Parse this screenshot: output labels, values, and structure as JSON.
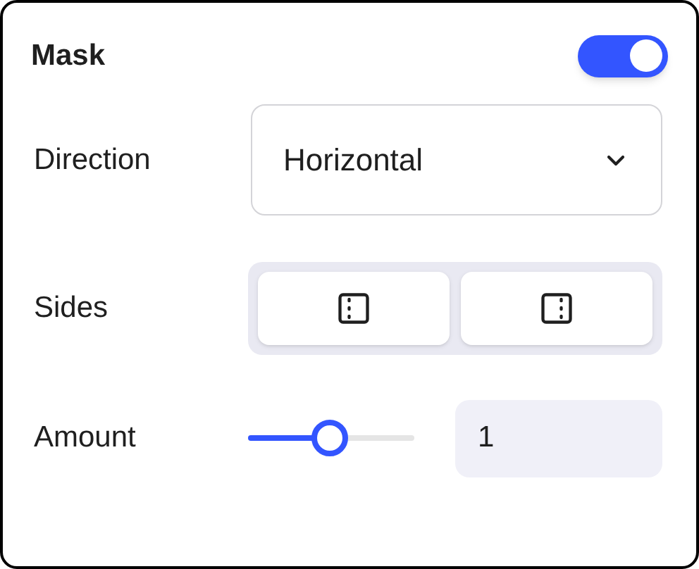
{
  "title": "Mask",
  "toggle": {
    "on": true
  },
  "rows": [
    {
      "kind": "select",
      "label": "Direction",
      "value": "Horizontal"
    },
    {
      "kind": "sides",
      "label": "Sides",
      "options": [
        {
          "kind": "left",
          "selected": true
        },
        {
          "kind": "right",
          "selected": true
        }
      ]
    },
    {
      "kind": "slider",
      "label": "Amount",
      "level": 0.49,
      "value": "1"
    }
  ]
}
